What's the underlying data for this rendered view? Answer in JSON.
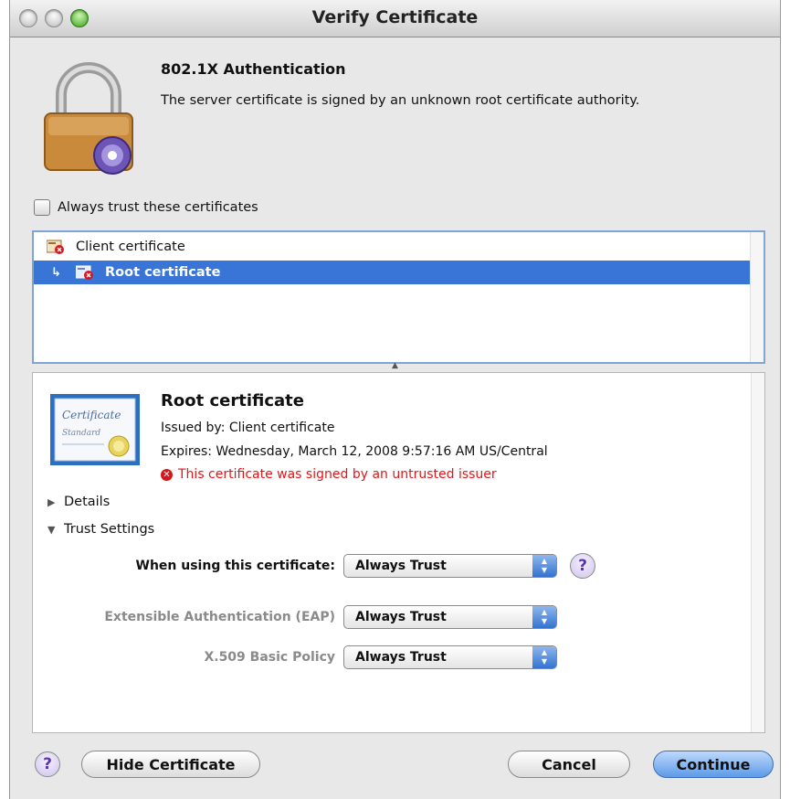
{
  "window": {
    "title": "Verify Certificate"
  },
  "header": {
    "title": "802.1X Authentication",
    "message": "The server certificate is signed by an unknown root certificate authority."
  },
  "trust_checkbox": {
    "label": "Always trust these certificates",
    "checked": false
  },
  "certificate_list": [
    {
      "label": "Client certificate",
      "selected": false,
      "icon": "cert-error-icon"
    },
    {
      "label": "Root certificate",
      "selected": true,
      "icon": "cert-error-icon"
    }
  ],
  "detail": {
    "name": "Root certificate",
    "issued_by": "Issued by: Client certificate",
    "expires": "Expires: Wednesday, March 12, 2008 9:57:16 AM US/Central",
    "warning": "This certificate was signed by an untrusted issuer",
    "warning_color": "#e0171a",
    "icon_text_1": "Certificate",
    "icon_text_2": "Standard",
    "details_label": "Details",
    "trust_label": "Trust Settings"
  },
  "trust_settings": {
    "when_using": {
      "label": "When using this certificate:",
      "value": "Always Trust"
    },
    "eap": {
      "label": "Extensible Authentication (EAP)",
      "value": "Always Trust"
    },
    "x509": {
      "label": "X.509 Basic Policy",
      "value": "Always Trust"
    }
  },
  "buttons": {
    "hide_certificate": "Hide Certificate",
    "cancel": "Cancel",
    "continue": "Continue",
    "help": "?"
  },
  "colors": {
    "selection": "#3875d7",
    "accent": "#3373d0"
  }
}
